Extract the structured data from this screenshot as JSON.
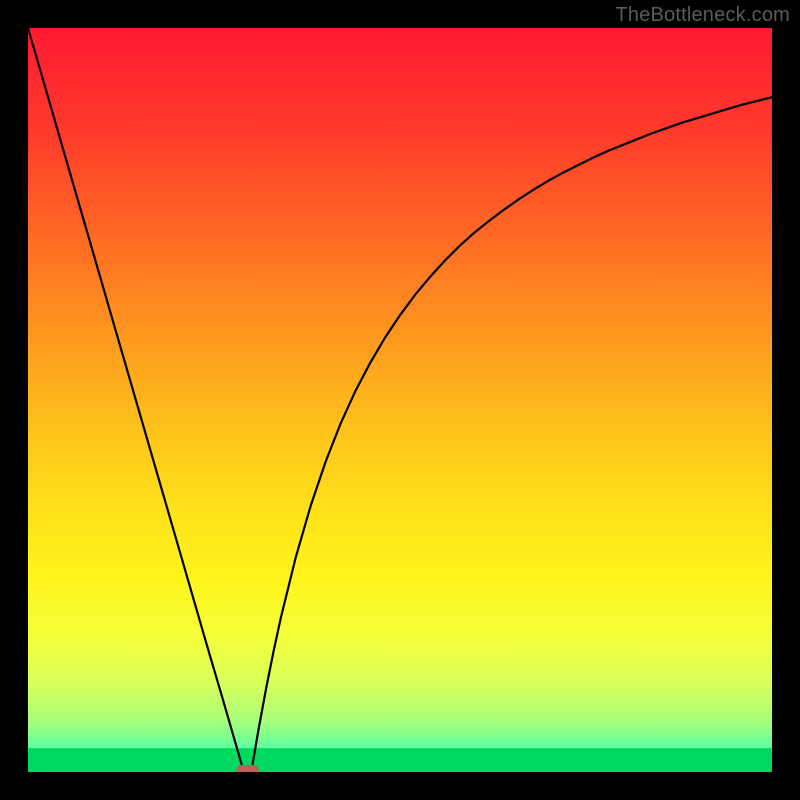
{
  "watermark": "TheBottleneck.com",
  "chart_data": {
    "type": "line",
    "title": "",
    "xlabel": "",
    "ylabel": "",
    "xlim": [
      0,
      100
    ],
    "ylim": [
      0,
      100
    ],
    "grid": false,
    "curve_x": [
      0,
      2,
      4,
      6,
      8,
      10,
      12,
      14,
      16,
      18,
      20,
      22,
      24,
      26,
      28,
      29,
      30,
      31,
      32,
      33,
      34,
      36,
      38,
      40,
      42,
      44,
      46,
      48,
      50,
      52,
      54,
      56,
      58,
      60,
      62,
      64,
      66,
      68,
      70,
      72,
      74,
      76,
      78,
      80,
      82,
      84,
      86,
      88,
      90,
      92,
      94,
      96,
      98,
      100
    ],
    "curve_y": [
      100,
      93.1,
      86.2,
      79.3,
      72.4,
      65.5,
      58.6,
      51.7,
      44.8,
      37.9,
      31.0,
      24.1,
      17.2,
      10.4,
      3.5,
      0.0,
      0.0,
      5.8,
      11.2,
      16.2,
      20.8,
      28.9,
      35.8,
      41.7,
      46.8,
      51.2,
      55.0,
      58.4,
      61.4,
      64.1,
      66.5,
      68.7,
      70.7,
      72.5,
      74.1,
      75.6,
      77.0,
      78.3,
      79.5,
      80.6,
      81.6,
      82.6,
      83.5,
      84.3,
      85.1,
      85.9,
      86.6,
      87.3,
      87.9,
      88.5,
      89.1,
      89.7,
      90.2,
      90.7
    ],
    "marker": {
      "x": 29.5,
      "y": 0.0
    },
    "bottom_green_band": {
      "y_from": 0,
      "y_to": 3.2
    },
    "gradient_stops": [
      {
        "offset": "0%",
        "color": "#ff1a33"
      },
      {
        "offset": "14%",
        "color": "#ff3a2a"
      },
      {
        "offset": "28%",
        "color": "#ff6a24"
      },
      {
        "offset": "42%",
        "color": "#ff9a1e"
      },
      {
        "offset": "55%",
        "color": "#ffc61a"
      },
      {
        "offset": "66%",
        "color": "#ffe41a"
      },
      {
        "offset": "74%",
        "color": "#fff41a"
      },
      {
        "offset": "82%",
        "color": "#f4ff3a"
      },
      {
        "offset": "88%",
        "color": "#d8ff5a"
      },
      {
        "offset": "93%",
        "color": "#a8ff78"
      },
      {
        "offset": "97%",
        "color": "#5affa0"
      },
      {
        "offset": "100%",
        "color": "#00e56a"
      }
    ]
  }
}
